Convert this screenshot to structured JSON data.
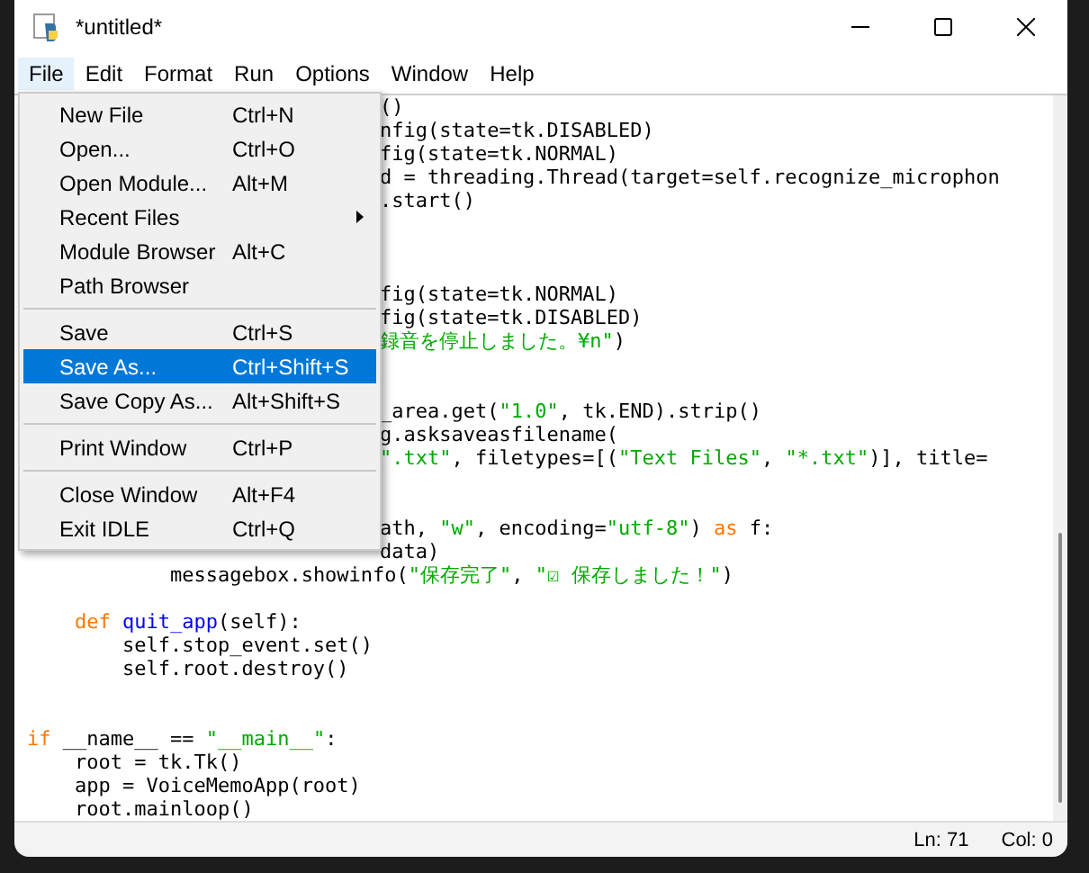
{
  "window": {
    "title": "*untitled*"
  },
  "menu_bar": [
    {
      "label": "File",
      "selected": true
    },
    {
      "label": "Edit",
      "selected": false
    },
    {
      "label": "Format",
      "selected": false
    },
    {
      "label": "Run",
      "selected": false
    },
    {
      "label": "Options",
      "selected": false
    },
    {
      "label": "Window",
      "selected": false
    },
    {
      "label": "Help",
      "selected": false
    }
  ],
  "file_menu": [
    {
      "kind": "item",
      "label": "New File",
      "shortcut": "Ctrl+N",
      "selected": false
    },
    {
      "kind": "item",
      "label": "Open...",
      "shortcut": "Ctrl+O",
      "selected": false
    },
    {
      "kind": "item",
      "label": "Open Module...",
      "shortcut": "Alt+M",
      "selected": false
    },
    {
      "kind": "submenu",
      "label": "Recent Files",
      "selected": false
    },
    {
      "kind": "item",
      "label": "Module Browser",
      "shortcut": "Alt+C",
      "selected": false
    },
    {
      "kind": "item",
      "label": "Path Browser",
      "selected": false
    },
    {
      "kind": "separator"
    },
    {
      "kind": "item",
      "label": "Save",
      "shortcut": "Ctrl+S",
      "selected": false
    },
    {
      "kind": "item",
      "label": "Save As...",
      "shortcut": "Ctrl+Shift+S",
      "selected": true
    },
    {
      "kind": "item",
      "label": "Save Copy As...",
      "shortcut": "Alt+Shift+S",
      "selected": false
    },
    {
      "kind": "separator"
    },
    {
      "kind": "item",
      "label": "Print Window",
      "shortcut": "Ctrl+P",
      "selected": false
    },
    {
      "kind": "separator"
    },
    {
      "kind": "item",
      "label": "Close Window",
      "shortcut": "Alt+F4",
      "selected": false
    },
    {
      "kind": "item",
      "label": "Exit IDLE",
      "shortcut": "Ctrl+Q",
      "selected": false
    }
  ],
  "code_lines": [
    {
      "kind": "covered",
      "segments": [
        {
          "kind": "plain",
          "text": "()"
        }
      ]
    },
    {
      "kind": "covered",
      "segments": [
        {
          "kind": "plain",
          "text": "nfig(state=tk.DISABLED)"
        }
      ]
    },
    {
      "kind": "covered",
      "segments": [
        {
          "kind": "plain",
          "text": "fig(state=tk.NORMAL)"
        }
      ]
    },
    {
      "kind": "covered",
      "segments": [
        {
          "kind": "plain",
          "text": "d = threading.Thread(target=self.recognize_microphon"
        }
      ]
    },
    {
      "kind": "covered",
      "segments": [
        {
          "kind": "plain",
          "text": ".start()"
        }
      ]
    },
    {
      "kind": "blank"
    },
    {
      "kind": "blank"
    },
    {
      "kind": "blank"
    },
    {
      "kind": "covered",
      "segments": [
        {
          "kind": "plain",
          "text": "fig(state=tk.NORMAL)"
        }
      ]
    },
    {
      "kind": "covered",
      "segments": [
        {
          "kind": "plain",
          "text": "fig(state=tk.DISABLED)"
        }
      ]
    },
    {
      "kind": "covered",
      "segments": [
        {
          "kind": "string",
          "text": "録音を停止しました。¥n\""
        },
        {
          "kind": "plain",
          "text": ")"
        }
      ]
    },
    {
      "kind": "blank"
    },
    {
      "kind": "blank"
    },
    {
      "kind": "covered",
      "segments": [
        {
          "kind": "plain",
          "text": "_area.get("
        },
        {
          "kind": "string",
          "text": "\"1.0\""
        },
        {
          "kind": "plain",
          "text": ", tk.END).strip()"
        }
      ]
    },
    {
      "kind": "covered",
      "segments": [
        {
          "kind": "plain",
          "text": "g.asksaveasfilename("
        }
      ]
    },
    {
      "kind": "covered",
      "segments": [
        {
          "kind": "string",
          "text": "\".txt\""
        },
        {
          "kind": "plain",
          "text": ", filetypes=[("
        },
        {
          "kind": "string",
          "text": "\"Text Files\""
        },
        {
          "kind": "plain",
          "text": ", "
        },
        {
          "kind": "string",
          "text": "\"*.txt\""
        },
        {
          "kind": "plain",
          "text": ")], title="
        }
      ]
    },
    {
      "kind": "blank"
    },
    {
      "kind": "blank"
    },
    {
      "kind": "covered",
      "segments": [
        {
          "kind": "plain",
          "text": "ath, "
        },
        {
          "kind": "string",
          "text": "\"w\""
        },
        {
          "kind": "plain",
          "text": ", encoding="
        },
        {
          "kind": "string",
          "text": "\"utf-8\""
        },
        {
          "kind": "plain",
          "text": ") "
        },
        {
          "kind": "keyword",
          "text": "as"
        },
        {
          "kind": "plain",
          "text": " f:"
        }
      ]
    },
    {
      "kind": "covered",
      "segments": [
        {
          "kind": "plain",
          "text": "data)"
        }
      ]
    },
    {
      "kind": "level3",
      "segments": [
        {
          "kind": "plain",
          "text": "messagebox.showinfo("
        },
        {
          "kind": "string",
          "text": "\"保存完了\""
        },
        {
          "kind": "plain",
          "text": ", "
        },
        {
          "kind": "string",
          "text": "\"☑ 保存しました！\""
        },
        {
          "kind": "plain",
          "text": ")"
        }
      ]
    },
    {
      "kind": "blank"
    },
    {
      "kind": "level1",
      "segments": [
        {
          "kind": "keyword",
          "text": "def"
        },
        {
          "kind": "definition",
          "text": "quit_app",
          "spaced": true
        },
        {
          "kind": "plain",
          "text": "(self):"
        }
      ]
    },
    {
      "kind": "level2",
      "segments": [
        {
          "kind": "plain",
          "text": "self.stop_event.set()"
        }
      ]
    },
    {
      "kind": "level2",
      "segments": [
        {
          "kind": "plain",
          "text": "self.root.destroy()"
        }
      ]
    },
    {
      "kind": "blank"
    },
    {
      "kind": "blank"
    },
    {
      "kind": "level0",
      "segments": [
        {
          "kind": "keyword",
          "text": "if"
        },
        {
          "kind": "plain",
          "text": "__name__ == ",
          "spaced": true
        },
        {
          "kind": "string",
          "text": "\"__main__\""
        },
        {
          "kind": "plain",
          "text": ":"
        }
      ]
    },
    {
      "kind": "level1",
      "segments": [
        {
          "kind": "plain",
          "text": "root = tk.Tk()"
        }
      ]
    },
    {
      "kind": "level1",
      "segments": [
        {
          "kind": "plain",
          "text": "app = VoiceMemoApp(root)"
        }
      ]
    },
    {
      "kind": "level1",
      "segments": [
        {
          "kind": "plain",
          "text": "root.mainloop()"
        }
      ]
    }
  ],
  "status_bar": {
    "line": "Ln: 71",
    "column": "Col: 0"
  }
}
